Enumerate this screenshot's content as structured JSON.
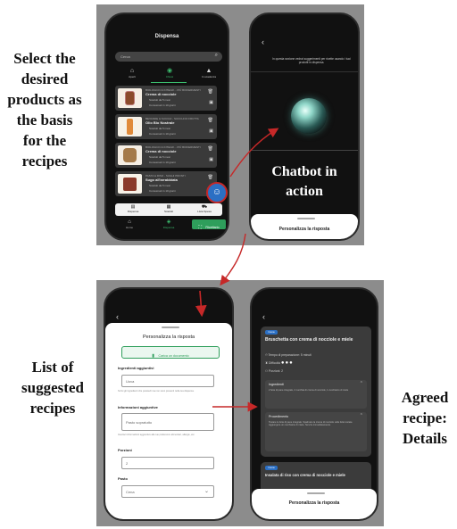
{
  "captions": {
    "select": [
      "Select the",
      "desired",
      "products as",
      "the basis",
      "for the",
      "recipes"
    ],
    "list": [
      "List of",
      "suggested",
      "recipes"
    ],
    "agreed": [
      "Agreed",
      "recipe:",
      "Details"
    ],
    "chatbot": [
      "Chatbot in",
      "action"
    ]
  },
  "screen1": {
    "title": "Dispensa",
    "search_placeholder": "Cerca",
    "filters": [
      "Aperti",
      "Chiusi",
      "In scadenza"
    ],
    "items": [
      {
        "cat": "BIOLOGICO & INTEGR. - PIÙ BIOFERMENTI",
        "name": "Crema di nocciole",
        "l1": "Scaduti da 5 mesi",
        "l2": "Consumati in 10 giorni"
      },
      {
        "cat": "BEVANDE & SUCCHI - SUCCHI DI FRUTTA",
        "name": "Olio Bio Nostrale",
        "l1": "Scaduti da 5 mesi",
        "l2": "Consumati in 10 giorni"
      },
      {
        "cat": "BIOLOGICO & INTEGR. - PIÙ BIOFERMENTI",
        "name": "Crema di nocciole",
        "l1": "Scaduti da 5 mesi",
        "l2": "Consumati in 10 giorni"
      },
      {
        "cat": "PASTA & RISO - SUGHI PRONTI",
        "name": "Sugo all'arrabbiata",
        "l1": "Scaduti da 5 mesi",
        "l2": "Consumati in 10 giorni"
      }
    ],
    "tabs": [
      "Dispensa",
      "Scaduti",
      "Lista Spesa"
    ],
    "bottom_nav": [
      "Home",
      "Dispensa"
    ],
    "ricettario_label": "Ricettario"
  },
  "screen2": {
    "header_text": "In questa sezione vedrai suggerimenti per ricette usando i tuoi prodotti in dispensa.",
    "personalize_label": "Personalizza la risposta"
  },
  "screen3": {
    "title": "Personalizza la risposta",
    "green_button": "Carica un documento",
    "field1_label": "Ingredienti aggiuntivi",
    "field1_value": "Uova",
    "field1_help": "Scrivi gli ingredienti che possiedi ma non sono presenti nella tua dispensa.",
    "field2_label": "Informazioni aggiuntive",
    "field2_value": "Pasto sopratutto",
    "field2_help": "Inserisci informazioni aggiuntive alle tue preferenze alimentari, allergie, etc.",
    "field3_label": "Porzioni",
    "field3_value": "2",
    "field4_label": "Pasto",
    "field4_value": "Cena"
  },
  "screen4": {
    "badge": "Cena",
    "recipe_title": "Bruschetta con crema di nocciole e miele",
    "time_label": "Tempo di preparazione: 5 minuti",
    "difficulty_label": "Difficoltà",
    "portions_label": "Porzioni: 2",
    "ingredients_label": "Ingredienti",
    "ingredients_text": "2 fette di pane integrale, 2 cucchiai di crema di nocciole, 1 cucchiaino di miele",
    "procedure_label": "Procedimento",
    "procedure_text": "Tostare le fette di pane integrale. Spalmare la crema di nocciole sulle fette tostate. Aggiungere un cucchiaino di miele. Servire immediatamente.",
    "badge2": "Cena",
    "recipe2_title": "Insalata di riso con crema di nocciole e miele",
    "personalize_label": "Personalizza la risposta"
  },
  "colors": {
    "accent_green": "#2e9e5b",
    "bubble_blue": "#2b6fc4",
    "bubble_ring": "#c62828",
    "arrow_red": "#c62828"
  }
}
